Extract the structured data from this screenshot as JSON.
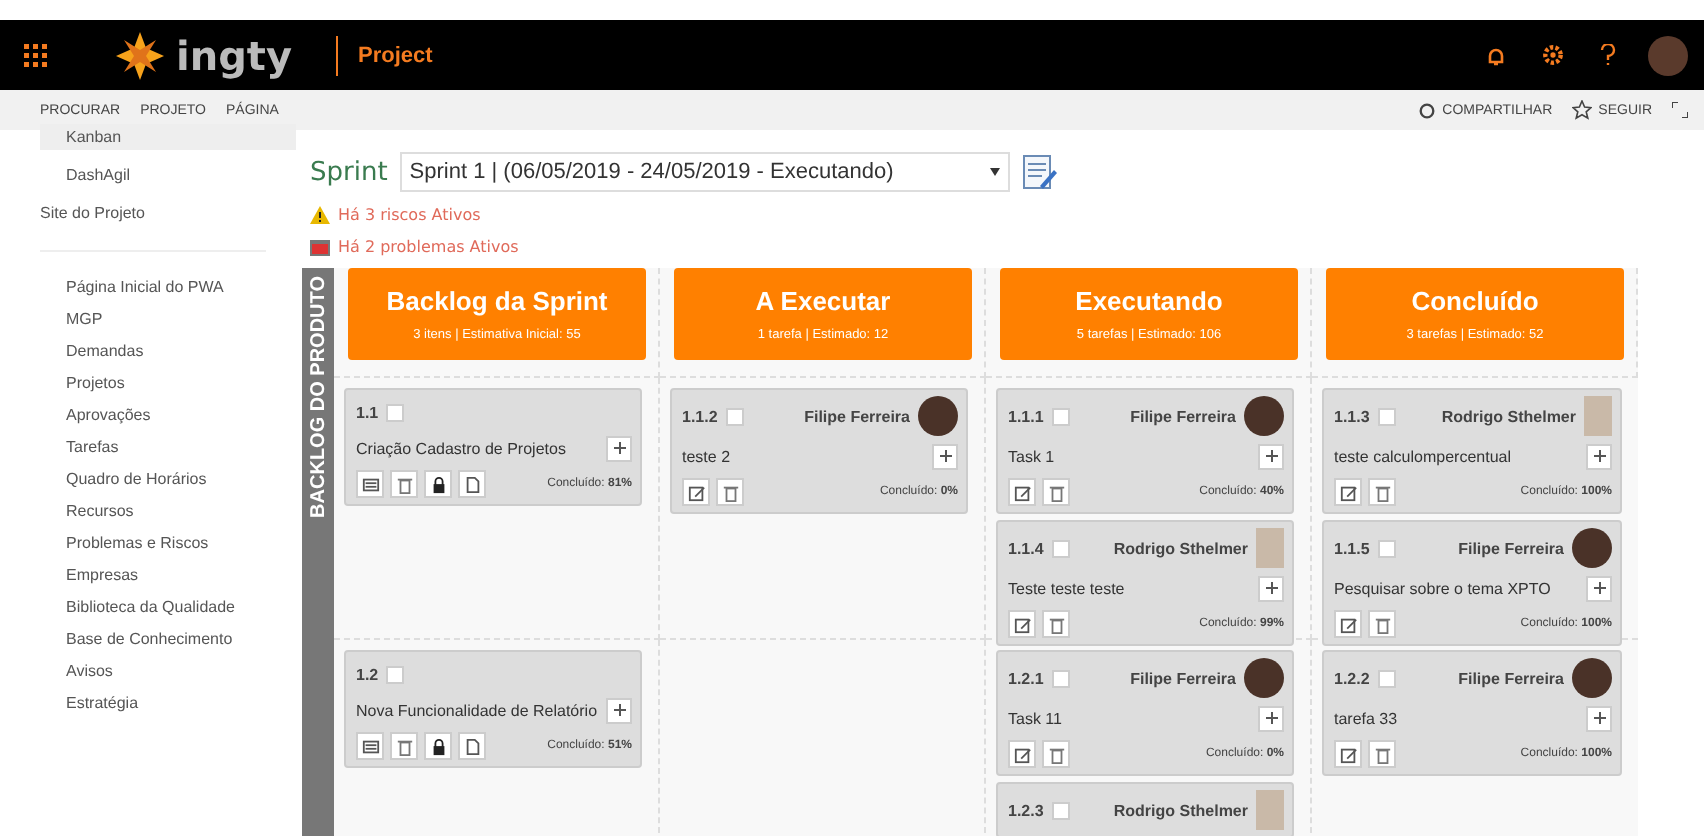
{
  "topbar": {
    "logo": "ingty",
    "app": "Project"
  },
  "ribbon": {
    "tabs": [
      "PROCURAR",
      "PROJETO",
      "PÁGINA"
    ],
    "actions": [
      {
        "kind": "share",
        "label": "COMPARTILHAR"
      },
      {
        "kind": "follow",
        "label": "SEGUIR"
      }
    ]
  },
  "sidebar": {
    "items": [
      {
        "label": "Kanban",
        "selected": true,
        "indented": true
      },
      {
        "label": "DashAgil",
        "selected": false,
        "indented": true
      },
      {
        "label": "Site do Projeto",
        "selected": false,
        "indented": false
      }
    ],
    "links": [
      "Página Inicial do PWA",
      "MGP",
      "Demandas",
      "Projetos",
      "Aprovações",
      "Tarefas",
      "Quadro de Horários",
      "Recursos",
      "Problemas e Riscos",
      "Empresas",
      "Biblioteca da Qualidade",
      "Base de Conhecimento",
      "Avisos",
      "Estratégia"
    ]
  },
  "sprint": {
    "label": "Sprint",
    "value": "Sprint 1 | (06/05/2019 - 24/05/2019 - Executando)"
  },
  "alerts": [
    {
      "kind": "risk",
      "text": "Há 3 riscos Ativos"
    },
    {
      "kind": "problem",
      "text": "Há 2 problemas Ativos"
    }
  ],
  "board": {
    "lane": "BACKLOG DO PRODUTO",
    "columns": [
      {
        "title": "Backlog da Sprint",
        "summary": "3 itens | Estimativa Inicial: 55"
      },
      {
        "title": "A Executar",
        "summary": "1 tarefa | Estimado: 12"
      },
      {
        "title": "Executando",
        "summary": "5 tarefas | Estimado: 106"
      },
      {
        "title": "Concluído",
        "summary": "3 tarefas | Estimado: 52"
      }
    ],
    "rows": [
      {
        "cells": [
          [
            {
              "kind": "item",
              "id": "1.1",
              "checked": false,
              "title": "Criação Cadastro de Projetos",
              "progress_label": "Concluído:",
              "progress": "81%"
            }
          ],
          [
            {
              "kind": "task",
              "id": "1.1.2",
              "checked": false,
              "owner": "Filipe Ferreira",
              "round_photo": true,
              "title": "teste 2",
              "progress_label": "Concluído:",
              "progress": "0%"
            }
          ],
          [
            {
              "kind": "task",
              "id": "1.1.1",
              "checked": false,
              "owner": "Filipe Ferreira",
              "round_photo": true,
              "title": "Task 1",
              "progress_label": "Concluído:",
              "progress": "40%"
            },
            {
              "kind": "task",
              "id": "1.1.4",
              "checked": false,
              "owner": "Rodrigo Sthelmer",
              "round_photo": false,
              "title": "Teste teste teste",
              "progress_label": "Concluído:",
              "progress": "99%"
            }
          ],
          [
            {
              "kind": "task",
              "id": "1.1.3",
              "checked": false,
              "owner": "Rodrigo Sthelmer",
              "round_photo": false,
              "title": "teste calculompercentual",
              "progress_label": "Concluído:",
              "progress": "100%"
            },
            {
              "kind": "task",
              "id": "1.1.5",
              "checked": false,
              "owner": "Filipe Ferreira",
              "round_photo": true,
              "title": "Pesquisar sobre o tema XPTO",
              "progress_label": "Concluído:",
              "progress": "100%"
            }
          ]
        ]
      },
      {
        "cells": [
          [
            {
              "kind": "item",
              "id": "1.2",
              "checked": false,
              "title": "Nova Funcionalidade de Relatório",
              "progress_label": "Concluído:",
              "progress": "51%"
            }
          ],
          [],
          [
            {
              "kind": "task",
              "id": "1.2.1",
              "checked": false,
              "owner": "Filipe Ferreira",
              "round_photo": true,
              "title": "Task 11",
              "progress_label": "Concluído:",
              "progress": "0%"
            },
            {
              "kind": "task",
              "id": "1.2.3",
              "checked": false,
              "owner": "Rodrigo Sthelmer",
              "round_photo": false
            }
          ],
          [
            {
              "kind": "task",
              "id": "1.2.2",
              "checked": false,
              "owner": "Filipe Ferreira",
              "round_photo": true,
              "title": "tarefa 33",
              "progress_label": "Concluído:",
              "progress": "100%"
            }
          ]
        ]
      }
    ]
  }
}
